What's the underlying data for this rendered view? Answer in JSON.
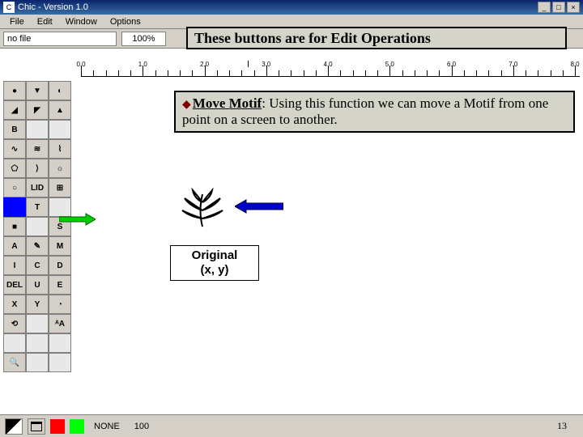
{
  "titlebar": {
    "icon_text": "C",
    "title": "Chic - Version 1.0",
    "minimize": "_",
    "maximize": "□",
    "close": "×"
  },
  "menubar": [
    "File",
    "Edit",
    "Window",
    "Options"
  ],
  "toolbar": {
    "file_value": "no file",
    "zoom": "100%"
  },
  "annotation1": "These buttons are for Edit Operations",
  "ruler": {
    "marks": [
      "0.0",
      "1.0",
      "2.0",
      "3.0",
      "4.0",
      "5.0",
      "6.0",
      "7.0",
      "8.0"
    ]
  },
  "annotation2": {
    "title": "Move Motif",
    "rest": ": Using this function we can move a Motif  from one point on a screen to another."
  },
  "palette": {
    "rows": [
      [
        "●",
        "▼",
        "◐"
      ],
      [
        "◢",
        "◤",
        "▲"
      ],
      [
        "B",
        "",
        ""
      ],
      [
        "∿",
        "≋",
        "⌇"
      ],
      [
        "⬠",
        "⟩",
        "☼"
      ],
      [
        "○",
        "LID",
        "⊞"
      ],
      [
        "",
        "T",
        ""
      ],
      [
        "■",
        "",
        "S"
      ],
      [
        "A",
        "✎",
        "M"
      ],
      [
        "I",
        "C",
        "D"
      ],
      [
        "DEL",
        "U",
        "E"
      ],
      [
        "X",
        "Y",
        "◔"
      ],
      [
        "⟲",
        "",
        "ᴬA"
      ],
      [
        "",
        "",
        ""
      ],
      [
        "🔍",
        "",
        ""
      ]
    ],
    "selected": [
      6,
      0
    ]
  },
  "original_box": {
    "line1": "Original",
    "line2": "(x, y)"
  },
  "statusbar": {
    "red": "#ff0000",
    "green": "#00ff00",
    "none_label": "NONE",
    "tool_value": "100",
    "slide_number": "13"
  }
}
